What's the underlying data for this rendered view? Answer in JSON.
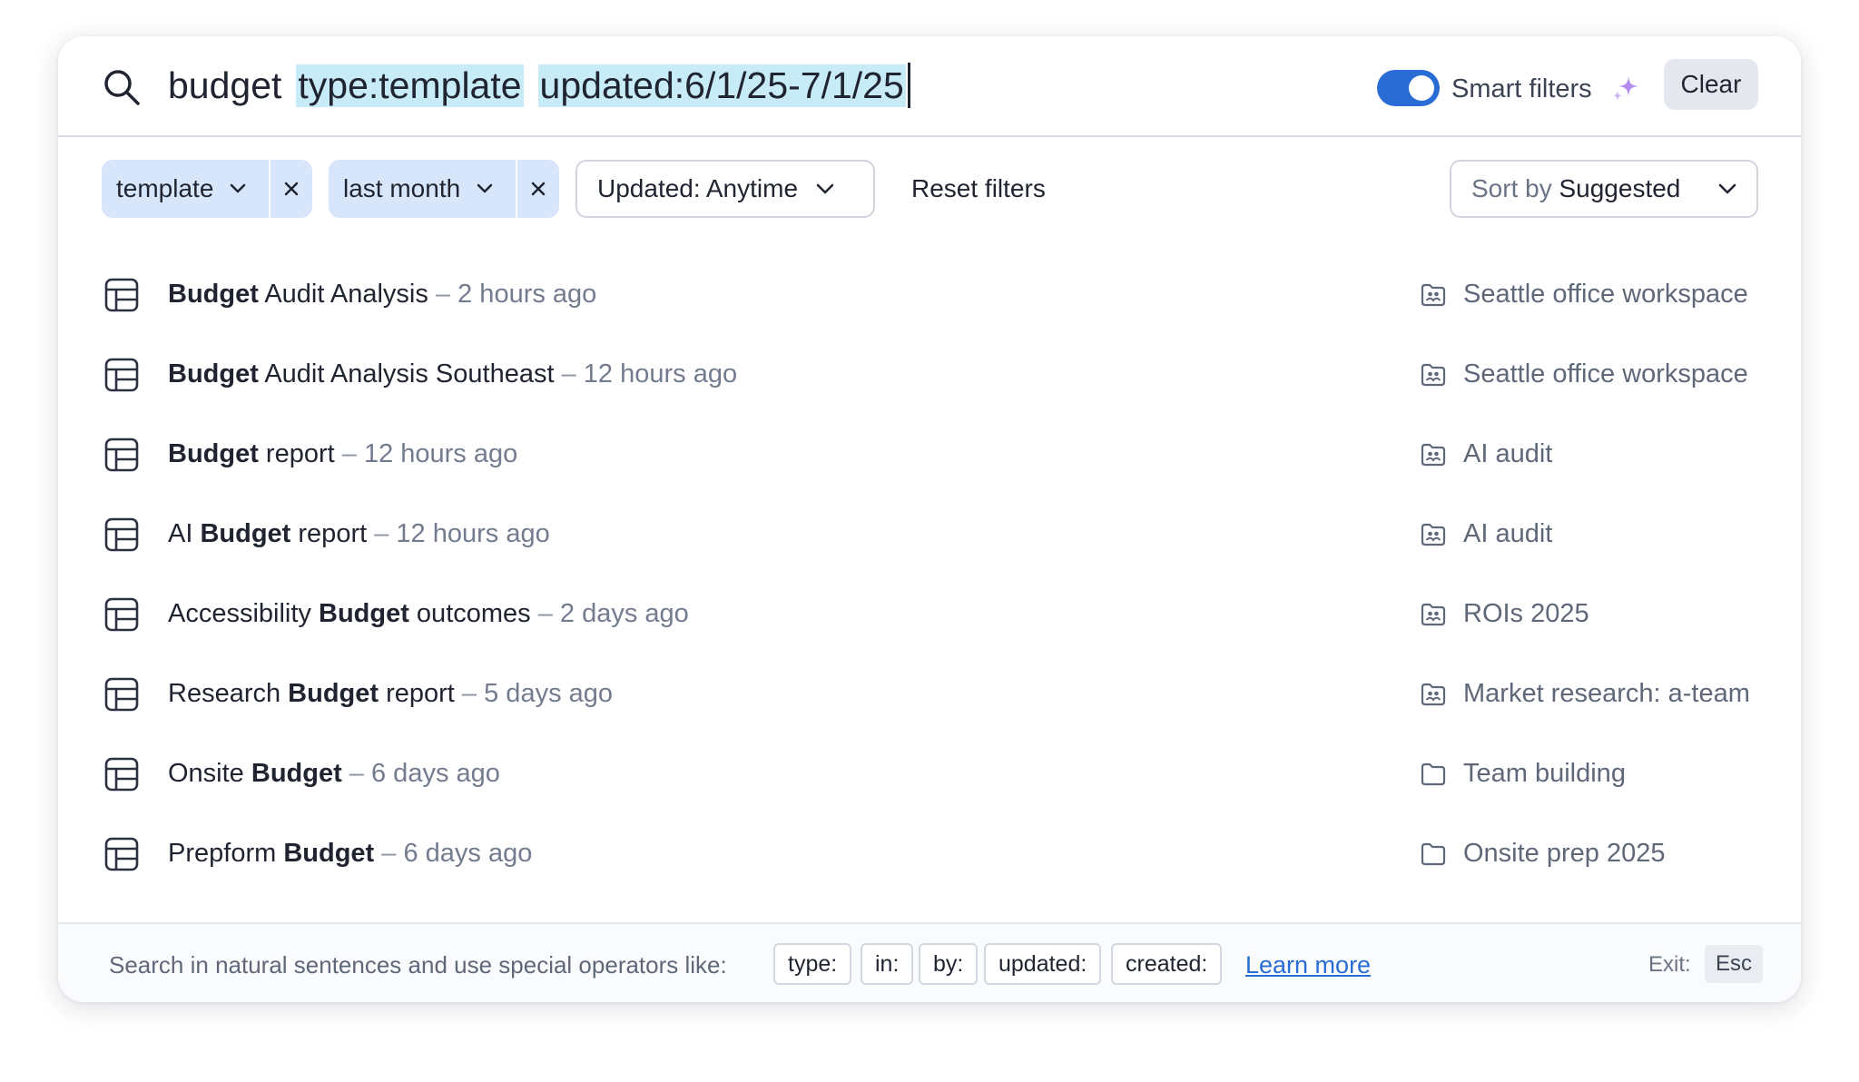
{
  "search": {
    "query_plain": "budget",
    "query_token_1": "type:template",
    "query_token_2": "updated:6/1/25-7/1/25",
    "smart_filters_label": "Smart filters",
    "smart_filters_on": true,
    "clear_label": "Clear"
  },
  "filters": {
    "chip_1": "template",
    "chip_2": "last month",
    "updated_dropdown": "Updated: Anytime",
    "reset_label": "Reset filters",
    "sort_prefix": "Sort by",
    "sort_value": "Suggested"
  },
  "results": [
    {
      "pre": "",
      "bold": "Budget",
      "post": " Audit Analysis",
      "sep": " – ",
      "time": "2 hours ago",
      "location": "Seattle office workspace",
      "loc_icon": "shared-folder-icon"
    },
    {
      "pre": "",
      "bold": "Budget",
      "post": " Audit Analysis Southeast",
      "sep": " – ",
      "time": "12 hours ago",
      "location": "Seattle office workspace",
      "loc_icon": "shared-folder-icon"
    },
    {
      "pre": "",
      "bold": "Budget",
      "post": " report",
      "sep": " – ",
      "time": "12 hours ago",
      "location": "AI audit",
      "loc_icon": "shared-folder-icon"
    },
    {
      "pre": "AI ",
      "bold": "Budget",
      "post": " report",
      "sep": " – ",
      "time": "12 hours ago",
      "location": "AI audit",
      "loc_icon": "shared-folder-icon"
    },
    {
      "pre": "Accessibility ",
      "bold": "Budget",
      "post": " outcomes",
      "sep": " – ",
      "time": "2 days ago",
      "location": "ROIs 2025",
      "loc_icon": "shared-folder-icon"
    },
    {
      "pre": "Research ",
      "bold": "Budget",
      "post": " report",
      "sep": " – ",
      "time": "5 days ago",
      "location": "Market research: a-team",
      "loc_icon": "shared-folder-icon"
    },
    {
      "pre": "Onsite ",
      "bold": "Budget",
      "post": "",
      "sep": " – ",
      "time": "6 days ago",
      "location": "Team building",
      "loc_icon": "folder-icon"
    },
    {
      "pre": "Prepform ",
      "bold": "Budget",
      "post": "",
      "sep": " – ",
      "time": "6 days ago",
      "location": "Onsite prep 2025",
      "loc_icon": "folder-icon"
    }
  ],
  "footer": {
    "hint": "Search in natural sentences and use special operators like:",
    "operators": [
      "type:",
      "in:",
      "by:",
      "updated:",
      "created:"
    ],
    "learn_more": "Learn more",
    "exit_label": "Exit:",
    "exit_key": "Esc"
  },
  "colors": {
    "accent": "#2a6cd6",
    "chip_bg": "#d8e6fb",
    "token_highlight": "#c8ecf7",
    "sparkle": "#b48cf0"
  }
}
